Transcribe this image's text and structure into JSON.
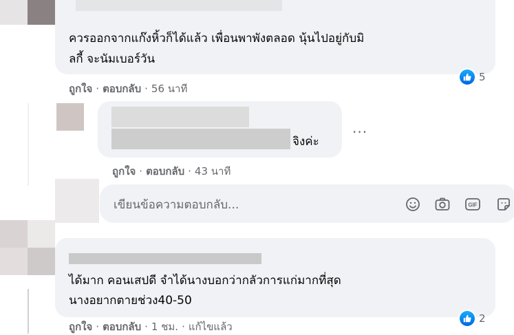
{
  "comments": [
    {
      "text_lines": [
        "ควรออกจากแก๊งหิ้วก็ได้แล้ว เพื่อนพาพังตลอด นุ้นไปอยู่กับมิ",
        "ลกี้ จะนัมเบอร์วัน"
      ],
      "like_label": "ถูกใจ",
      "reply_label": "ตอบกลับ",
      "time": "56 นาที",
      "reaction_count": "5"
    },
    {
      "text": "จิงค่ะ",
      "like_label": "ถูกใจ",
      "reply_label": "ตอบกลับ",
      "time": "43 นาที",
      "more_icon": "more-horizontal-icon"
    },
    {
      "text_lines": [
        "ได้มาก คอนเสปดี จำได้นางบอกว่ากลัวการแก่มากที่สุด",
        "นางอยากตายช่วง40-50"
      ],
      "like_label": "ถูกใจ",
      "reply_label": "ตอบกลับ",
      "time": "1 ชม.",
      "edited_label": "แก้ไขแล้ว",
      "reaction_count": "2"
    }
  ],
  "reply_box": {
    "placeholder": "เขียนข้อความตอบกลับ...",
    "icons": [
      "emoji-icon",
      "camera-icon",
      "gif-icon",
      "sticker-icon"
    ]
  },
  "colors": {
    "bubble": "#f0f2f5",
    "meta_text": "#65676b",
    "like_blue": "#1877f2"
  }
}
